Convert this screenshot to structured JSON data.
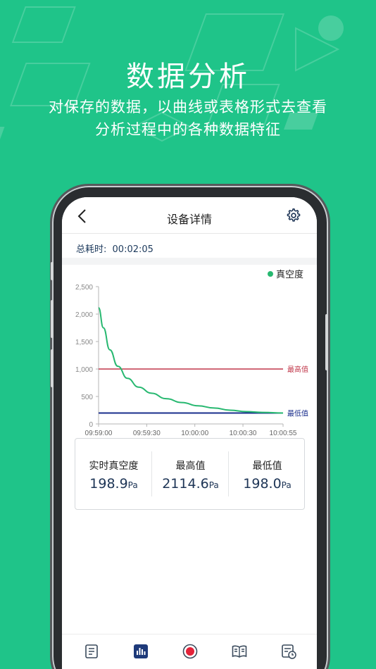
{
  "promo": {
    "title": "数据分析",
    "subtitle_line1": "对保存的数据，以曲线或表格形式去查看",
    "subtitle_line2": "分析过程中的各种数据特征"
  },
  "nav": {
    "title": "设备详情",
    "back_icon": "chevron-left-icon",
    "settings_icon": "gear-icon"
  },
  "session": {
    "total_time_label": "总耗时:",
    "total_time_value": "00:02:05"
  },
  "colors": {
    "background": "#1fc489",
    "series": "#27b870",
    "max_line": "#c0374a",
    "min_line": "#1a2e8c",
    "text_dark": "#1e3556"
  },
  "chart_data": {
    "type": "line",
    "title": "",
    "xlabel": "",
    "ylabel": "",
    "ylim": [
      0,
      2500
    ],
    "y_ticks": [
      "0",
      "500",
      "1,000",
      "1,500",
      "2,000",
      "2,500"
    ],
    "x_ticks": [
      "09:59:00",
      "09:59:30",
      "10:00:00",
      "10:00:30",
      "10:00:55"
    ],
    "legend": {
      "position": "top-right",
      "entries": [
        "真空度"
      ]
    },
    "series": [
      {
        "name": "真空度",
        "x": [
          "09:59:00",
          "09:59:03",
          "09:59:07",
          "09:59:12",
          "09:59:18",
          "09:59:25",
          "09:59:33",
          "09:59:42",
          "09:59:52",
          "10:00:02",
          "10:00:12",
          "10:00:22",
          "10:00:32",
          "10:00:42",
          "10:00:55"
        ],
        "y": [
          2115,
          1750,
          1350,
          1050,
          830,
          670,
          560,
          460,
          390,
          330,
          290,
          250,
          225,
          210,
          199
        ]
      }
    ],
    "reference_lines": [
      {
        "label": "最高值",
        "y": 1000
      },
      {
        "label": "最低值",
        "y": 198
      }
    ]
  },
  "stats": [
    {
      "label": "实时真空度",
      "value": "198.9",
      "unit": "Pa"
    },
    {
      "label": "最高值",
      "value": "2114.6",
      "unit": "Pa"
    },
    {
      "label": "最低值",
      "value": "198.0",
      "unit": "Pa"
    }
  ],
  "tabs": [
    {
      "icon": "report-icon",
      "active": false
    },
    {
      "icon": "bar-chart-icon",
      "active": true
    },
    {
      "icon": "record-icon",
      "active": false
    },
    {
      "icon": "manual-icon",
      "active": false
    },
    {
      "icon": "history-icon",
      "active": false
    }
  ]
}
